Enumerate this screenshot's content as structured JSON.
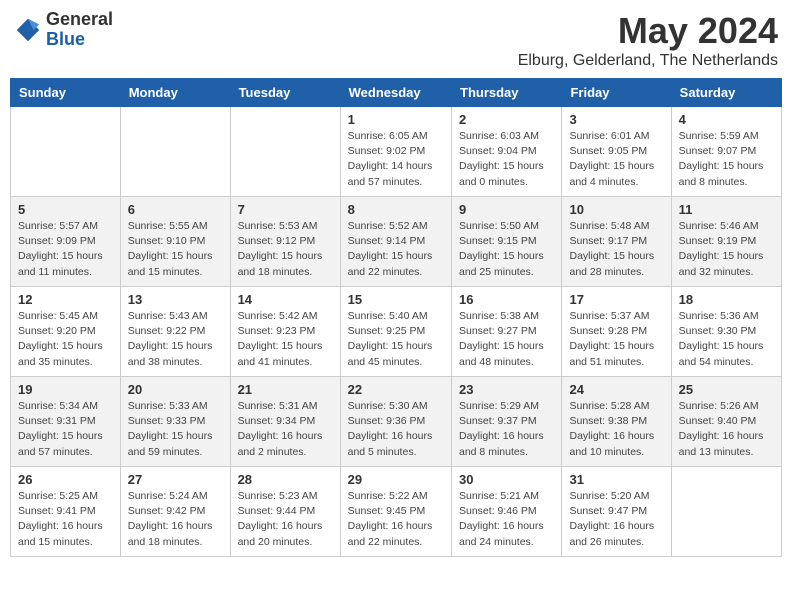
{
  "header": {
    "logo_line1": "General",
    "logo_line2": "Blue",
    "month_title": "May 2024",
    "subtitle": "Elburg, Gelderland, The Netherlands"
  },
  "days_of_week": [
    "Sunday",
    "Monday",
    "Tuesday",
    "Wednesday",
    "Thursday",
    "Friday",
    "Saturday"
  ],
  "weeks": [
    [
      {
        "day": "",
        "info": ""
      },
      {
        "day": "",
        "info": ""
      },
      {
        "day": "",
        "info": ""
      },
      {
        "day": "1",
        "info": "Sunrise: 6:05 AM\nSunset: 9:02 PM\nDaylight: 14 hours\nand 57 minutes."
      },
      {
        "day": "2",
        "info": "Sunrise: 6:03 AM\nSunset: 9:04 PM\nDaylight: 15 hours\nand 0 minutes."
      },
      {
        "day": "3",
        "info": "Sunrise: 6:01 AM\nSunset: 9:05 PM\nDaylight: 15 hours\nand 4 minutes."
      },
      {
        "day": "4",
        "info": "Sunrise: 5:59 AM\nSunset: 9:07 PM\nDaylight: 15 hours\nand 8 minutes."
      }
    ],
    [
      {
        "day": "5",
        "info": "Sunrise: 5:57 AM\nSunset: 9:09 PM\nDaylight: 15 hours\nand 11 minutes."
      },
      {
        "day": "6",
        "info": "Sunrise: 5:55 AM\nSunset: 9:10 PM\nDaylight: 15 hours\nand 15 minutes."
      },
      {
        "day": "7",
        "info": "Sunrise: 5:53 AM\nSunset: 9:12 PM\nDaylight: 15 hours\nand 18 minutes."
      },
      {
        "day": "8",
        "info": "Sunrise: 5:52 AM\nSunset: 9:14 PM\nDaylight: 15 hours\nand 22 minutes."
      },
      {
        "day": "9",
        "info": "Sunrise: 5:50 AM\nSunset: 9:15 PM\nDaylight: 15 hours\nand 25 minutes."
      },
      {
        "day": "10",
        "info": "Sunrise: 5:48 AM\nSunset: 9:17 PM\nDaylight: 15 hours\nand 28 minutes."
      },
      {
        "day": "11",
        "info": "Sunrise: 5:46 AM\nSunset: 9:19 PM\nDaylight: 15 hours\nand 32 minutes."
      }
    ],
    [
      {
        "day": "12",
        "info": "Sunrise: 5:45 AM\nSunset: 9:20 PM\nDaylight: 15 hours\nand 35 minutes."
      },
      {
        "day": "13",
        "info": "Sunrise: 5:43 AM\nSunset: 9:22 PM\nDaylight: 15 hours\nand 38 minutes."
      },
      {
        "day": "14",
        "info": "Sunrise: 5:42 AM\nSunset: 9:23 PM\nDaylight: 15 hours\nand 41 minutes."
      },
      {
        "day": "15",
        "info": "Sunrise: 5:40 AM\nSunset: 9:25 PM\nDaylight: 15 hours\nand 45 minutes."
      },
      {
        "day": "16",
        "info": "Sunrise: 5:38 AM\nSunset: 9:27 PM\nDaylight: 15 hours\nand 48 minutes."
      },
      {
        "day": "17",
        "info": "Sunrise: 5:37 AM\nSunset: 9:28 PM\nDaylight: 15 hours\nand 51 minutes."
      },
      {
        "day": "18",
        "info": "Sunrise: 5:36 AM\nSunset: 9:30 PM\nDaylight: 15 hours\nand 54 minutes."
      }
    ],
    [
      {
        "day": "19",
        "info": "Sunrise: 5:34 AM\nSunset: 9:31 PM\nDaylight: 15 hours\nand 57 minutes."
      },
      {
        "day": "20",
        "info": "Sunrise: 5:33 AM\nSunset: 9:33 PM\nDaylight: 15 hours\nand 59 minutes."
      },
      {
        "day": "21",
        "info": "Sunrise: 5:31 AM\nSunset: 9:34 PM\nDaylight: 16 hours\nand 2 minutes."
      },
      {
        "day": "22",
        "info": "Sunrise: 5:30 AM\nSunset: 9:36 PM\nDaylight: 16 hours\nand 5 minutes."
      },
      {
        "day": "23",
        "info": "Sunrise: 5:29 AM\nSunset: 9:37 PM\nDaylight: 16 hours\nand 8 minutes."
      },
      {
        "day": "24",
        "info": "Sunrise: 5:28 AM\nSunset: 9:38 PM\nDaylight: 16 hours\nand 10 minutes."
      },
      {
        "day": "25",
        "info": "Sunrise: 5:26 AM\nSunset: 9:40 PM\nDaylight: 16 hours\nand 13 minutes."
      }
    ],
    [
      {
        "day": "26",
        "info": "Sunrise: 5:25 AM\nSunset: 9:41 PM\nDaylight: 16 hours\nand 15 minutes."
      },
      {
        "day": "27",
        "info": "Sunrise: 5:24 AM\nSunset: 9:42 PM\nDaylight: 16 hours\nand 18 minutes."
      },
      {
        "day": "28",
        "info": "Sunrise: 5:23 AM\nSunset: 9:44 PM\nDaylight: 16 hours\nand 20 minutes."
      },
      {
        "day": "29",
        "info": "Sunrise: 5:22 AM\nSunset: 9:45 PM\nDaylight: 16 hours\nand 22 minutes."
      },
      {
        "day": "30",
        "info": "Sunrise: 5:21 AM\nSunset: 9:46 PM\nDaylight: 16 hours\nand 24 minutes."
      },
      {
        "day": "31",
        "info": "Sunrise: 5:20 AM\nSunset: 9:47 PM\nDaylight: 16 hours\nand 26 minutes."
      },
      {
        "day": "",
        "info": ""
      }
    ]
  ]
}
